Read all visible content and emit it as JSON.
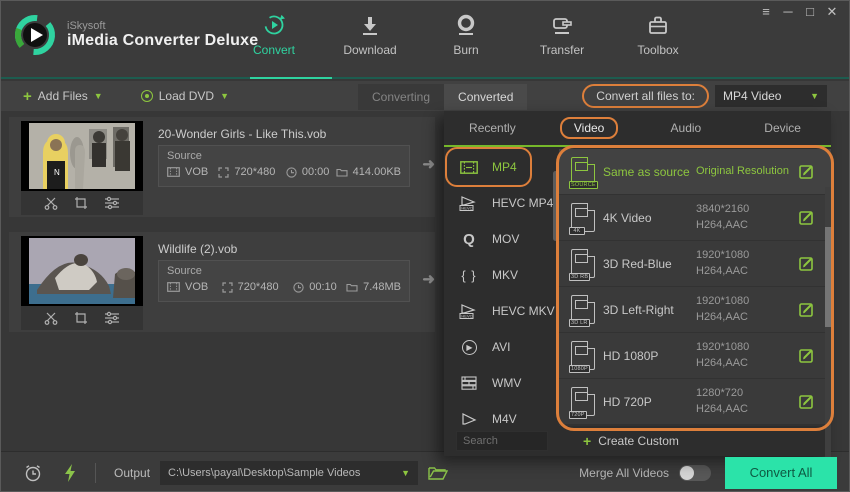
{
  "colors": {
    "accent_green": "#8dc63f",
    "accent_teal": "#2fd3a0",
    "annotation_orange": "#dd7f3b",
    "convert_button": "#2be3a9"
  },
  "window": {
    "controls": [
      {
        "name": "menu-icon",
        "glyph": "≡"
      },
      {
        "name": "minimize-icon",
        "glyph": "─"
      },
      {
        "name": "maximize-icon",
        "glyph": "□"
      },
      {
        "name": "close-icon",
        "glyph": "✕"
      }
    ]
  },
  "header": {
    "brand": {
      "line1": "iSkysoft",
      "line2": "iMedia Converter Deluxe"
    },
    "nav": [
      {
        "label": "Convert",
        "icon": "convert-icon",
        "active": true
      },
      {
        "label": "Download",
        "icon": "download-icon",
        "active": false
      },
      {
        "label": "Burn",
        "icon": "burn-icon",
        "active": false
      },
      {
        "label": "Transfer",
        "icon": "transfer-icon",
        "active": false
      },
      {
        "label": "Toolbox",
        "icon": "toolbox-icon",
        "active": false
      }
    ]
  },
  "toolbar": {
    "add_files_label": "Add Files",
    "load_dvd_label": "Load DVD",
    "tabs": [
      {
        "label": "Converting"
      },
      {
        "label": "Converted"
      }
    ],
    "convert_all_label": "Convert all files to:",
    "selected_output_format": "MP4 Video"
  },
  "files": [
    {
      "name": "20-Wonder Girls - Like This.vob",
      "source_label": "Source",
      "format": "VOB",
      "resolution": "720*480",
      "duration": "00:00",
      "size": "414.00KB"
    },
    {
      "name": "Wildlife  (2).vob",
      "source_label": "Source",
      "format": "VOB",
      "resolution": "720*480",
      "duration": "00:10",
      "size": "7.48MB"
    }
  ],
  "panel": {
    "tabs": [
      "Recently",
      "Video",
      "Audio",
      "Device"
    ],
    "active_tab": "Video",
    "formats": [
      {
        "label": "MP4",
        "selected": true
      },
      {
        "label": "HEVC MP4",
        "selected": false
      },
      {
        "label": "MOV",
        "selected": false
      },
      {
        "label": "MKV",
        "selected": false
      },
      {
        "label": "HEVC MKV",
        "selected": false
      },
      {
        "label": "AVI",
        "selected": false
      },
      {
        "label": "WMV",
        "selected": false
      },
      {
        "label": "M4V",
        "selected": false
      }
    ],
    "presets": [
      {
        "name": "Same as source",
        "badge": "SOURCE",
        "res": "Original Resolution",
        "codec": "",
        "selected": true
      },
      {
        "name": "4K Video",
        "badge": "4K",
        "res": "3840*2160",
        "codec": "H264,AAC",
        "selected": false
      },
      {
        "name": "3D Red-Blue",
        "badge": "3D RB",
        "res": "1920*1080",
        "codec": "H264,AAC",
        "selected": false
      },
      {
        "name": "3D Left-Right",
        "badge": "3D LR",
        "res": "1920*1080",
        "codec": "H264,AAC",
        "selected": false
      },
      {
        "name": "HD 1080P",
        "badge": "1080P",
        "res": "1920*1080",
        "codec": "H264,AAC",
        "selected": false
      },
      {
        "name": "HD 720P",
        "badge": "720P",
        "res": "1280*720",
        "codec": "H264,AAC",
        "selected": false
      }
    ],
    "search_placeholder": "Search",
    "create_custom_label": "Create Custom"
  },
  "footer": {
    "output_label": "Output",
    "output_path": "C:\\Users\\payal\\Desktop\\Sample Videos",
    "merge_label": "Merge All Videos",
    "merge_on": false,
    "convert_all_label": "Convert All"
  }
}
